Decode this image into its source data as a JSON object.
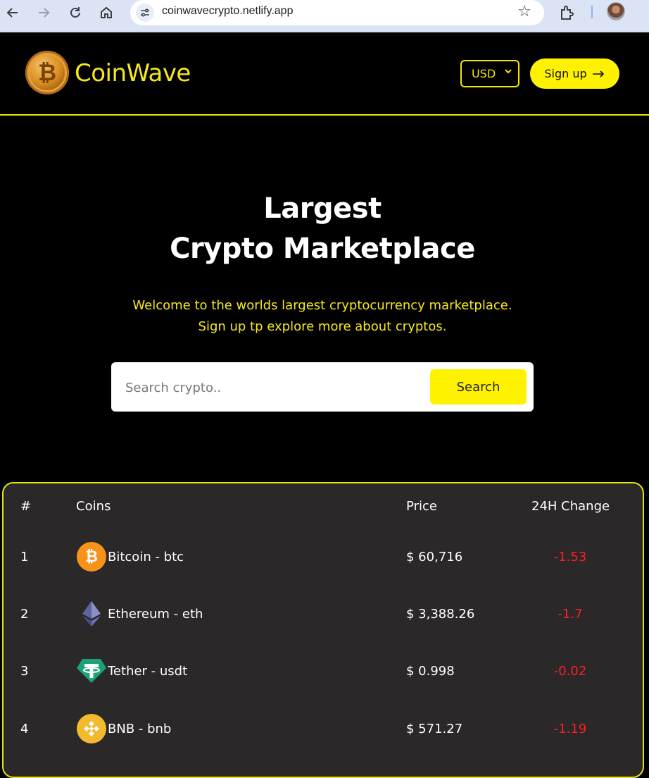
{
  "browser": {
    "url": "coinwavecrypto.netlify.app"
  },
  "header": {
    "brand": "CoinWave",
    "currency": "USD",
    "signup_label": "Sign up",
    "accent_color": "#f3e600"
  },
  "hero": {
    "title_line1": "Largest",
    "title_line2": "Crypto Marketplace",
    "sub_line1": "Welcome to the worlds largest cryptocurrency marketplace.",
    "sub_line2": "Sign up tp explore more about cryptos."
  },
  "search": {
    "placeholder": "Search crypto..",
    "button_label": "Search"
  },
  "table": {
    "headers": [
      "#",
      "Coins",
      "Price",
      "24H Change"
    ],
    "rows": [
      {
        "rank": "1",
        "coin": "Bitcoin - btc",
        "price": "$ 60,716",
        "change": "-1.53",
        "icon": "bitcoin-icon"
      },
      {
        "rank": "2",
        "coin": "Ethereum - eth",
        "price": "$ 3,388.26",
        "change": "-1.7",
        "icon": "ethereum-icon"
      },
      {
        "rank": "3",
        "coin": "Tether - usdt",
        "price": "$ 0.998",
        "change": "-0.02",
        "icon": "tether-icon"
      },
      {
        "rank": "4",
        "coin": "BNB - bnb",
        "price": "$ 571.27",
        "change": "-1.19",
        "icon": "bnb-icon"
      }
    ]
  }
}
